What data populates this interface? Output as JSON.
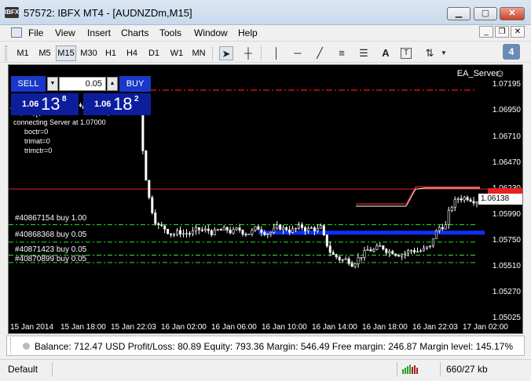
{
  "window": {
    "app_icon": "IBFX",
    "title": "57572: IBFX MT4 - [AUDNZDm,M15]",
    "minimize_icon": "minimize-icon",
    "maximize_icon": "maximize-icon",
    "close_icon": "close-icon"
  },
  "menu": {
    "items": [
      "File",
      "View",
      "Insert",
      "Charts",
      "Tools",
      "Window",
      "Help"
    ]
  },
  "toolbar": {
    "timeframes": [
      "M1",
      "M5",
      "M15",
      "M30",
      "H1",
      "H4",
      "D1",
      "W1",
      "MN"
    ],
    "active_timeframe": "M15",
    "tools": [
      "cursor-icon",
      "crosshair-icon",
      "vertical-line-icon",
      "horizontal-line-icon",
      "trendline-icon",
      "fibonacci-icon",
      "channel-icon",
      "text-icon",
      "label-icon",
      "arrows-icon"
    ],
    "text_tool": "A",
    "notifications": "4"
  },
  "chart": {
    "symbol": "AUDNZDm",
    "timeframe": "M15",
    "ea_name": "EA_Server",
    "comment_lines": [
      "connecting Server at 1.07000",
      "boctr=0",
      "trimat=0",
      "trimctr=0"
    ],
    "one_click": {
      "sell_label": "SELL",
      "buy_label": "BUY",
      "lot": "0.05",
      "sell_big": "1.06",
      "sell_main": "13",
      "sell_sup": "8",
      "buy_big": "1.06",
      "buy_main": "18",
      "buy_sup": "2"
    },
    "bid": "1.06138",
    "price_ticks": [
      "1.07195",
      "1.06950",
      "1.06710",
      "1.06470",
      "1.06230",
      "1.05990",
      "1.05750",
      "1.05510",
      "1.05270",
      "1.05025"
    ],
    "time_ticks": [
      "15 Jan 2014",
      "15 Jan 18:00",
      "15 Jan 22:03",
      "16 Jan 02:00",
      "16 Jan 06:00",
      "16 Jan 10:00",
      "16 Jan 14:00",
      "16 Jan 18:00",
      "16 Jan 22:03",
      "17 Jan 02:00"
    ],
    "orders": [
      "#40867154 buy 1.00",
      "#40868368 buy 0.05",
      "#40871423 buy 0.05",
      "#40870899 buy 0.05"
    ],
    "colors": {
      "background": "#000000",
      "bull": "#ffffff",
      "bear": "#ffffff",
      "ask_line": "#e82020",
      "order_line": "#22cc22",
      "zone": "#1030ff",
      "sl_line": "#cc1010"
    }
  },
  "chart_data": {
    "type": "candlestick",
    "ylim": [
      1.05025,
      1.0727
    ],
    "levels": {
      "stop_line": 1.0705,
      "ask": 1.06182,
      "bid": 1.06138,
      "order_1": 1.05868,
      "order_2": 1.05715,
      "order_3": 1.056,
      "order_4": 1.05535,
      "zone_low": 1.05785,
      "zone_high": 1.05815
    }
  },
  "account": {
    "text": "Balance: 712.47 USD  Profit/Loss: 80.89  Equity: 793.36  Margin: 546.49  Free margin: 246.87  Margin level: 145.17%"
  },
  "status": {
    "profile": "Default",
    "connection": "660/27 kb"
  }
}
